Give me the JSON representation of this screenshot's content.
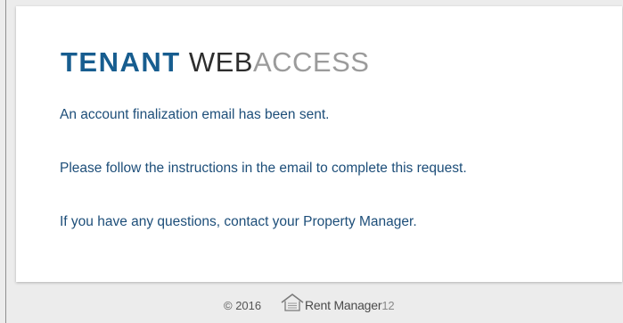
{
  "logo": {
    "word1": "TENANT",
    "word2": "WEB",
    "word3": "ACCESS"
  },
  "messages": [
    "An account finalization email has been sent.",
    "Please follow the instructions in the email to complete this request.",
    "If you have any questions, contact your Property Manager."
  ],
  "footer": {
    "copyright": "© 2016",
    "brand": "Rent Manager",
    "version": "12",
    "brand_icon": "house-logo-icon"
  },
  "colors": {
    "accent": "#175d8f",
    "text": "#1d4e79",
    "page_background": "#ececec",
    "card_background": "#ffffff"
  }
}
